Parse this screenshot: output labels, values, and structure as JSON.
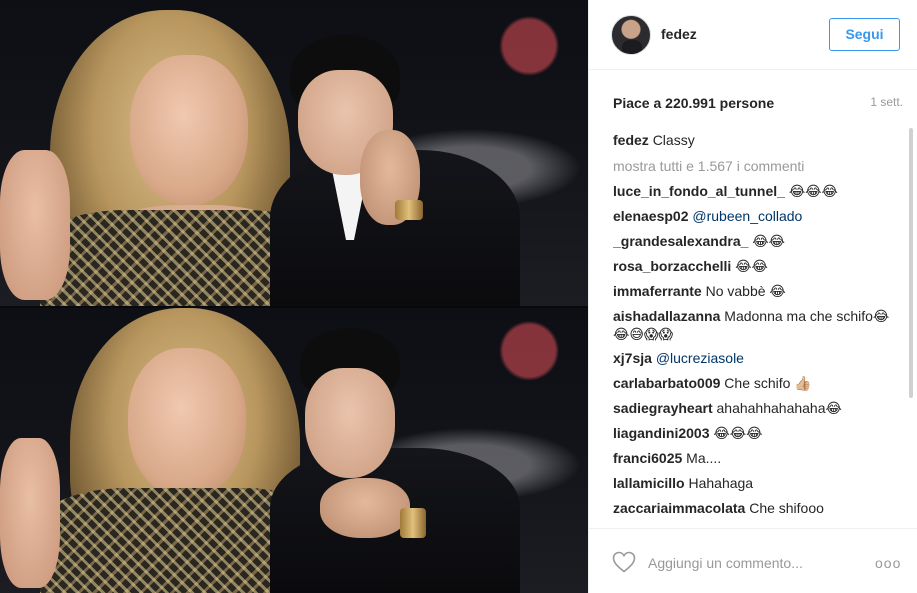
{
  "header": {
    "username": "fedez",
    "follow_label": "Segui"
  },
  "stats": {
    "likes": "Piace a 220.991 persone",
    "time": "1 sett."
  },
  "caption": {
    "user": "fedez",
    "text": "Classy"
  },
  "show_all": "mostra tutti e 1.567 i commenti",
  "comments": [
    {
      "user": "luce_in_fondo_al_tunnel_",
      "text": "😂😂😂"
    },
    {
      "user": "elenaesp02",
      "text": "@rubeen_collado",
      "mention": true
    },
    {
      "user": "_grandesalexandra_",
      "text": "😂😂"
    },
    {
      "user": "rosa_borzacchelli",
      "text": "😂😂"
    },
    {
      "user": "immaferrante",
      "text": "No vabbè 😂"
    },
    {
      "user": "aishadallazanna",
      "text": "Madonna ma che schifo😂😂😅😱😱"
    },
    {
      "user": "xj7sja",
      "text": "@lucreziasole",
      "mention": true
    },
    {
      "user": "carlabarbato009",
      "text": "Che schifo 👍🏼"
    },
    {
      "user": "sadiegrayheart",
      "text": "ahahahhahahaha😂"
    },
    {
      "user": "liagandini2003",
      "text": "😂😂😂"
    },
    {
      "user": "franci6025",
      "text": "Ma...."
    },
    {
      "user": "lallamicillo",
      "text": "Hahahaga"
    },
    {
      "user": "zaccariaimmacolata",
      "text": "Che shifooo"
    }
  ],
  "footer": {
    "add_comment_placeholder": "Aggiungi un commento...",
    "more_label": "ooo"
  },
  "colors": {
    "accent": "#3897f0",
    "mention": "#003569",
    "muted": "#999999"
  },
  "icons": {
    "like": "heart-outline-icon",
    "more": "more-options-icon"
  }
}
